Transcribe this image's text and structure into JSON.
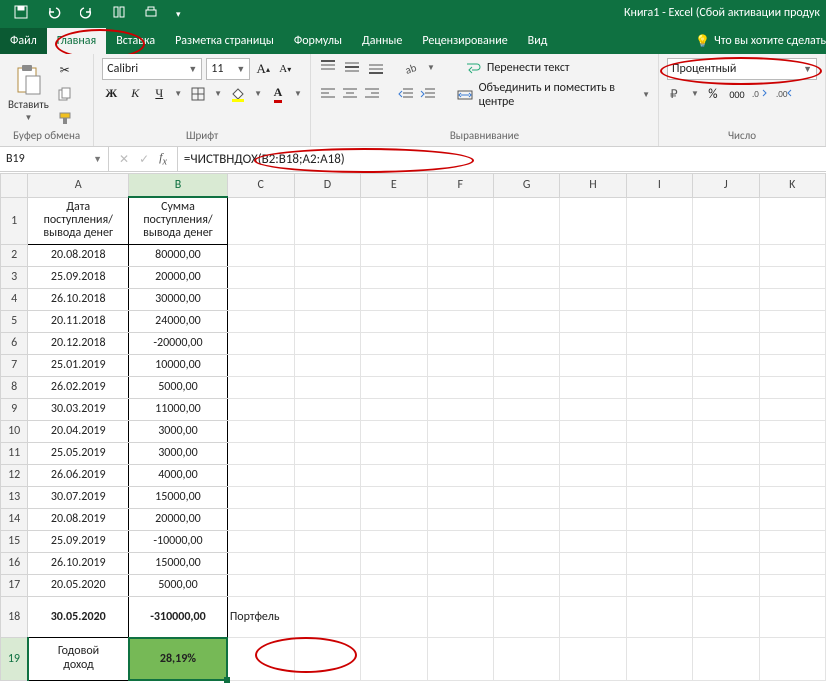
{
  "window": {
    "title": "Книга1 - Excel (Сбой активации продук"
  },
  "qat": {
    "save_icon": "save-icon",
    "undo_icon": "undo-icon",
    "redo_icon": "redo-icon",
    "touch_icon": "touch-mode-icon",
    "print_icon": "quick-print-icon"
  },
  "tabs": {
    "file": "Файл",
    "home": "Главная",
    "insert": "Вставка",
    "page_layout": "Разметка страницы",
    "formulas": "Формулы",
    "data": "Данные",
    "review": "Рецензирование",
    "view": "Вид",
    "tell_me": "Что вы хотите сделать"
  },
  "ribbon": {
    "clipboard": {
      "paste": "Вставить",
      "group_label": "Буфер обмена"
    },
    "font": {
      "font_name": "Calibri",
      "font_size": "11",
      "group_label": "Шрифт",
      "bold": "Ж",
      "italic": "К",
      "underline": "Ч"
    },
    "alignment": {
      "wrap_text": "Перенести текст",
      "merge_center": "Объединить и поместить в центре",
      "group_label": "Выравнивание"
    },
    "number": {
      "format": "Процентный",
      "percent": "%",
      "comma": "000",
      "inc_dec_placeholder": "",
      "group_label": "Число"
    }
  },
  "namebox": {
    "ref": "B19"
  },
  "formula_bar": {
    "formula": "=ЧИСТВНДОХ(B2:B18;A2:A18)"
  },
  "columns": [
    "A",
    "B",
    "C",
    "D",
    "E",
    "F",
    "G",
    "H",
    "I",
    "J",
    "K"
  ],
  "headers": {
    "A": "Дата поступления/вывода денег",
    "B": "Сумма поступления/вывода денег"
  },
  "rows": [
    {
      "n": 2,
      "A": "20.08.2018",
      "B": "80000,00"
    },
    {
      "n": 3,
      "A": "25.09.2018",
      "B": "20000,00"
    },
    {
      "n": 4,
      "A": "26.10.2018",
      "B": "30000,00"
    },
    {
      "n": 5,
      "A": "20.11.2018",
      "B": "24000,00"
    },
    {
      "n": 6,
      "A": "20.12.2018",
      "B": "-20000,00"
    },
    {
      "n": 7,
      "A": "25.01.2019",
      "B": "10000,00"
    },
    {
      "n": 8,
      "A": "26.02.2019",
      "B": "5000,00"
    },
    {
      "n": 9,
      "A": "30.03.2019",
      "B": "11000,00"
    },
    {
      "n": 10,
      "A": "20.04.2019",
      "B": "3000,00"
    },
    {
      "n": 11,
      "A": "25.05.2019",
      "B": "3000,00"
    },
    {
      "n": 12,
      "A": "26.06.2019",
      "B": "4000,00"
    },
    {
      "n": 13,
      "A": "30.07.2019",
      "B": "15000,00"
    },
    {
      "n": 14,
      "A": "20.08.2019",
      "B": "20000,00"
    },
    {
      "n": 15,
      "A": "25.09.2019",
      "B": "-10000,00"
    },
    {
      "n": 16,
      "A": "26.10.2019",
      "B": "15000,00"
    },
    {
      "n": 17,
      "A": "20.05.2020",
      "B": "5000,00"
    }
  ],
  "row18": {
    "n": 18,
    "A": "30.05.2020",
    "B": "-310000,00",
    "C": "Портфель"
  },
  "row19": {
    "n": 19,
    "A": "Годовой доход",
    "B": "28,19%"
  },
  "colors": {
    "excel_green": "#0f7141",
    "result_fill": "#76b956",
    "annot": "#c00000"
  }
}
